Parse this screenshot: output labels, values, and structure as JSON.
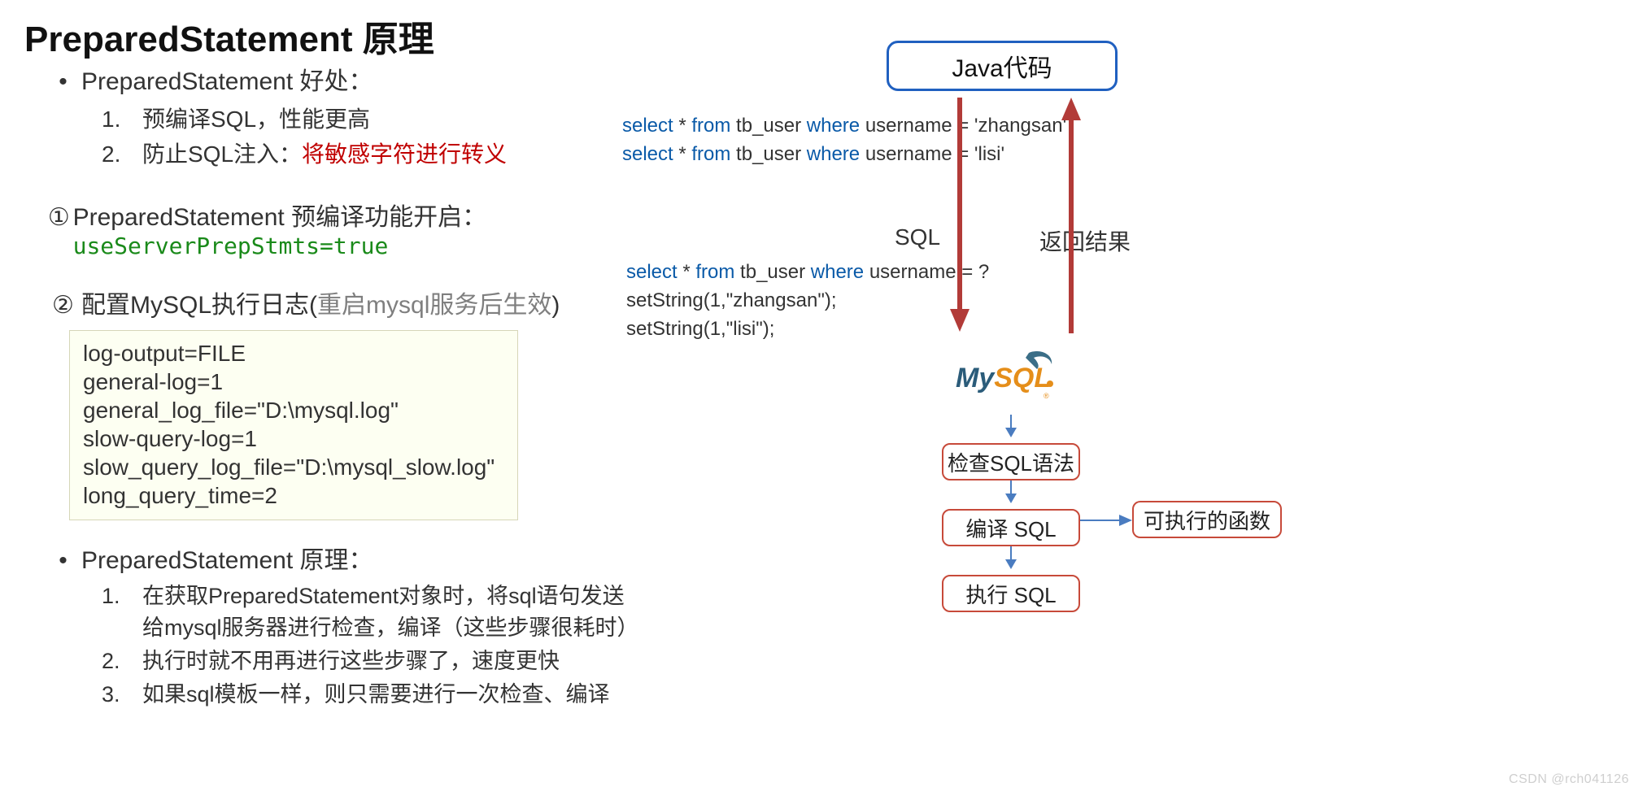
{
  "title": "PreparedStatement 原理",
  "benefits": {
    "heading": "PreparedStatement 好处：",
    "items": [
      {
        "num": "1.",
        "text": "预编译SQL，性能更高"
      },
      {
        "num": "2.",
        "text_prefix": "防止SQL注入：",
        "text_red": "将敏感字符进行转义"
      }
    ]
  },
  "step1": {
    "num": "①",
    "text": "PreparedStatement 预编译功能开启：",
    "code": "useServerPrepStmts=true"
  },
  "step2": {
    "num": "②",
    "text_prefix": "配置MySQL执行日志(",
    "text_gray": "重启mysql服务后生效",
    "text_suffix": ")"
  },
  "config": {
    "l1": "log-output=FILE",
    "l2": "general-log=1",
    "l3": "general_log_file=\"D:\\mysql.log\"",
    "l4": "slow-query-log=1",
    "l5": "slow_query_log_file=\"D:\\mysql_slow.log\"",
    "l6": "long_query_time=2"
  },
  "principle": {
    "heading": "PreparedStatement 原理：",
    "items": [
      {
        "num": "1.",
        "text": "在获取PreparedStatement对象时，将sql语句发送给mysql服务器进行检查，编译（这些步骤很耗时）"
      },
      {
        "num": "2.",
        "text": "执行时就不用再进行这些步骤了，速度更快"
      },
      {
        "num": "3.",
        "text": "如果sql模板一样，则只需要进行一次检查、编译"
      }
    ]
  },
  "diagram": {
    "java_box": "Java代码",
    "q1": {
      "a": {
        "p1": "select",
        "p2": " * ",
        "p3": "from",
        "p4": " tb_user ",
        "p5": "where",
        "p6": " username = 'zhangsan'"
      },
      "b": {
        "p1": "select",
        "p2": " * ",
        "p3": "from",
        "p4": " tb_user ",
        "p5": "where",
        "p6": " username = 'lisi'"
      }
    },
    "q2": {
      "a": {
        "p1": "select",
        "p2": " * ",
        "p3": "from",
        "p4": " tb_user ",
        "p5": "where",
        "p6": " username = ?"
      },
      "b": "setString(1,\"zhangsan\");",
      "c": "setString(1,\"lisi\");"
    },
    "sql_label": "SQL",
    "return_label": "返回结果",
    "mysql": {
      "text": "MySQL",
      "dot_color": "#f39c12",
      "text_color_my": "#2b5c7a",
      "text_color_sql": "#e58e1a"
    },
    "steps": {
      "s1": "检查SQL语法",
      "s2": "编译 SQL",
      "s3": "执行 SQL",
      "fn": "可执行的函数"
    }
  },
  "watermark": "CSDN @rch041126"
}
